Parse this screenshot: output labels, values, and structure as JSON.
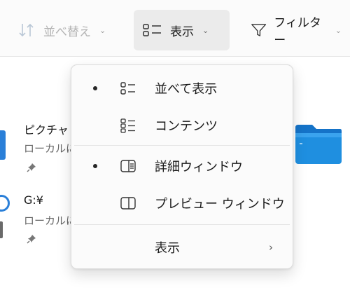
{
  "toolbar": {
    "sort": {
      "label": "並べ替え",
      "icon": "sort-icon"
    },
    "view": {
      "label": "表示",
      "icon": "list-view-icon"
    },
    "filter": {
      "label": "フィルター",
      "icon": "filter-icon"
    }
  },
  "items": [
    {
      "title": "ピクチャ",
      "subtitle": "ローカルに"
    },
    {
      "title": "G:¥",
      "subtitle": "ローカルに"
    }
  ],
  "menu": {
    "items": [
      {
        "label": "並べて表示",
        "icon": "tiles-view-icon",
        "selected": true
      },
      {
        "label": "コンテンツ",
        "icon": "content-view-icon",
        "selected": false
      },
      {
        "label": "詳細ウィンドウ",
        "icon": "details-pane-icon",
        "selected": true
      },
      {
        "label": "プレビュー ウィンドウ",
        "icon": "preview-pane-icon",
        "selected": false
      },
      {
        "label": "表示",
        "icon": "",
        "selected": false,
        "has_submenu": true
      }
    ]
  },
  "colors": {
    "accent": "#2a7fd8",
    "folder": "#1f8fe0",
    "disabled_text": "#b3b3b3"
  }
}
